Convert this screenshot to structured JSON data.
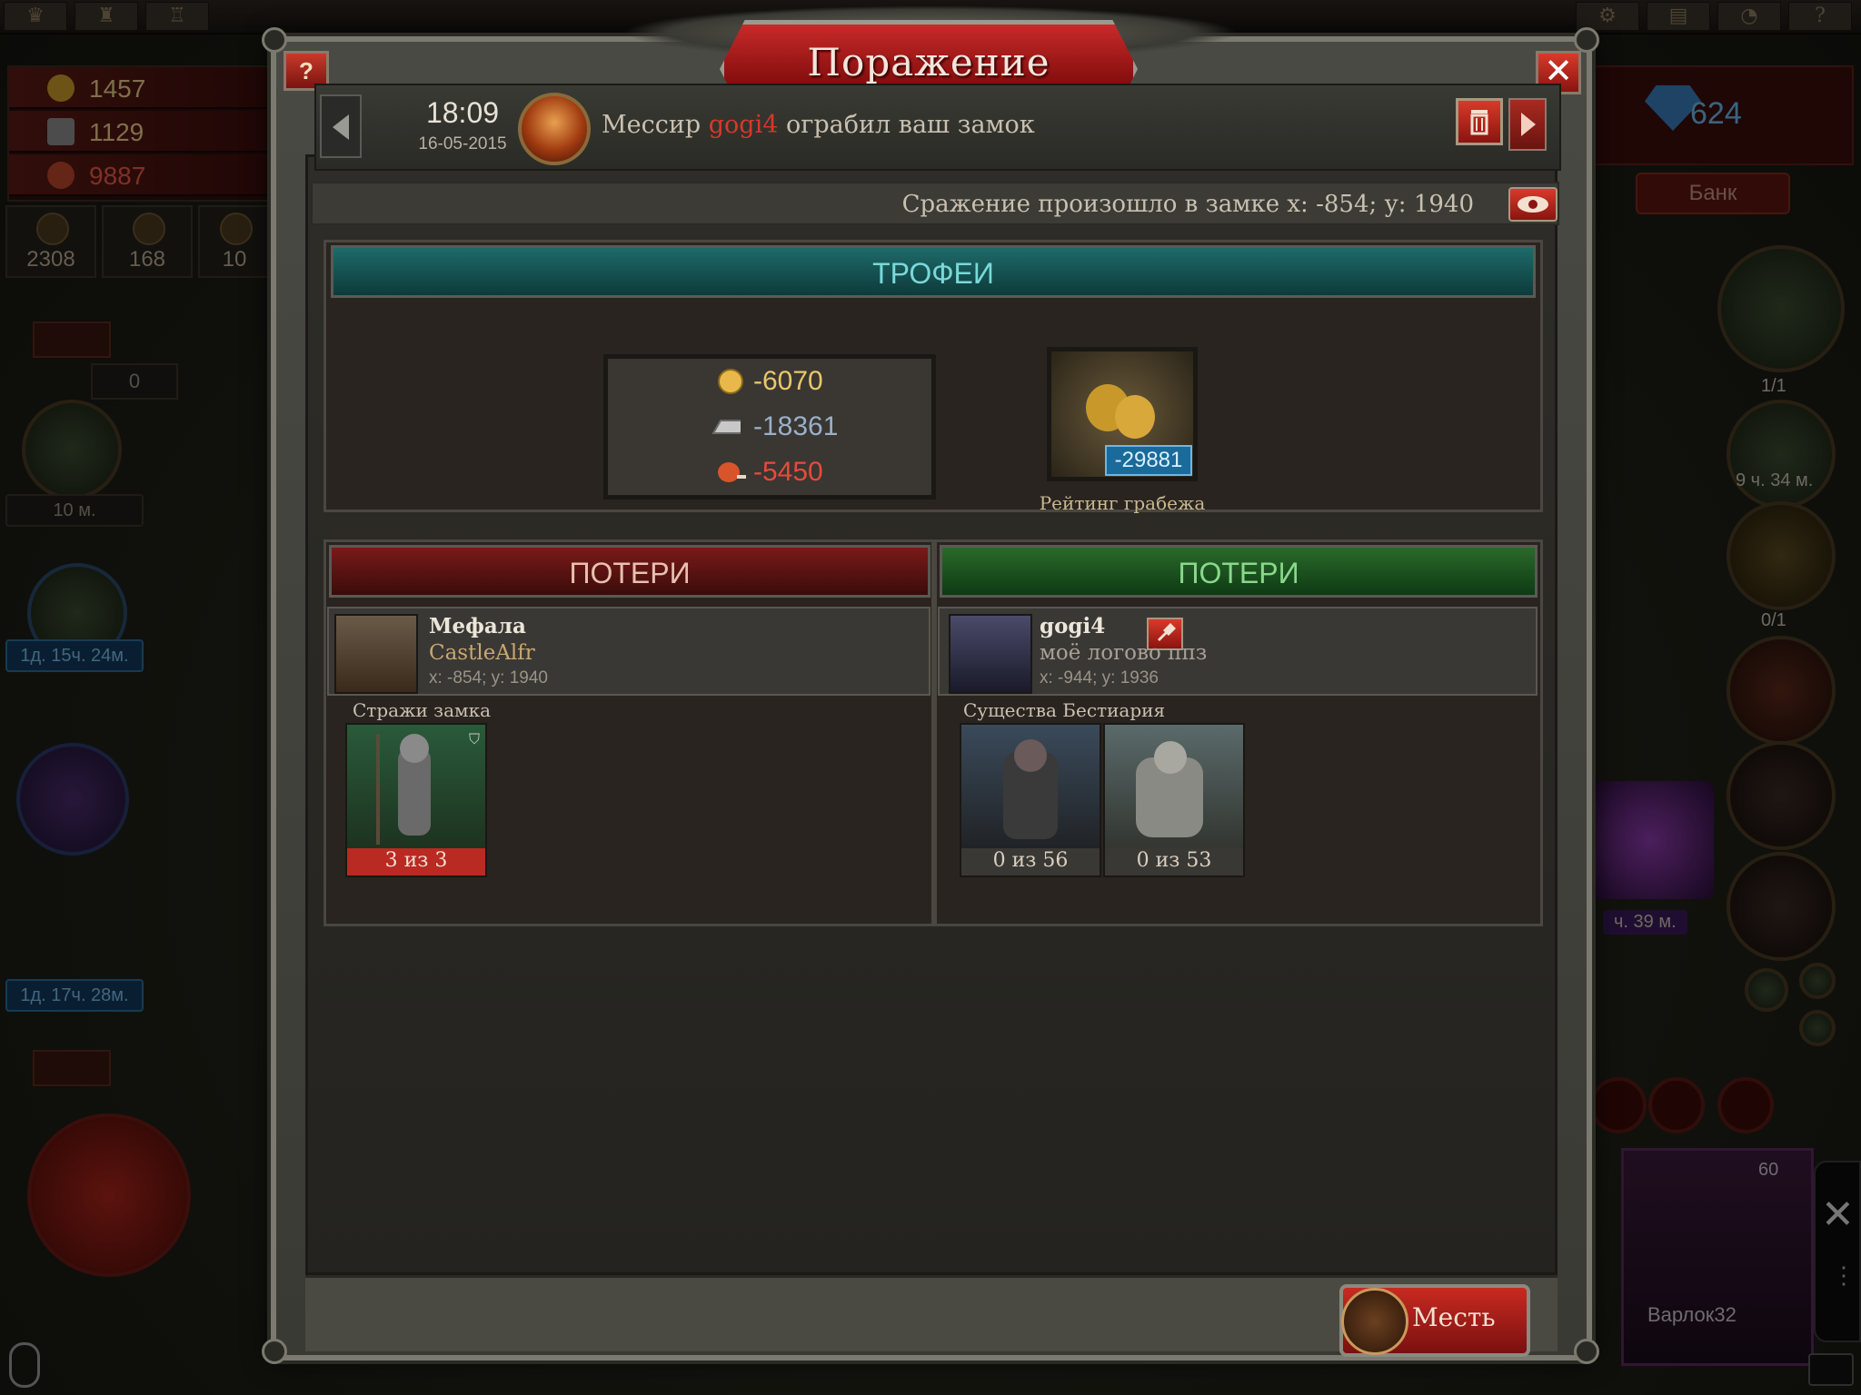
{
  "hud": {
    "resources": [
      {
        "name": "gold",
        "value": "1457",
        "color": "#e8b84a"
      },
      {
        "name": "iron",
        "value": "1129",
        "color": "#a0a0a0"
      },
      {
        "name": "food",
        "value": "9887",
        "color": "#c8542a"
      }
    ],
    "stats": [
      "2308",
      "168",
      "10"
    ],
    "counter": "0",
    "left_timers": [
      "10 м.",
      "1д. 15ч. 24м.",
      "1д. 17ч. 28м."
    ],
    "gems": "624",
    "bank_label": "Банк",
    "right_counts": [
      "1/1",
      "0/1"
    ],
    "right_timers": [
      "9 ч. 34 м.",
      "ч. 39 м."
    ],
    "player_label": "Варлок32",
    "player_level": "60"
  },
  "modal": {
    "title": "Поражение",
    "help_label": "?",
    "close_label": "✕",
    "report": {
      "time": "18:09",
      "date": "16-05-2015",
      "msg_prefix": "Мессир",
      "attacker": "gogi4",
      "msg_suffix": "ограбил ваш замок"
    },
    "battle_location": "Сражение произошло в замке х: -854; у: 1940",
    "trophies": {
      "header": "ТРОФЕИ",
      "gold": "-6070",
      "iron": "-18361",
      "food": "-5450",
      "rating_value": "-29881",
      "rating_label": "Рейтинг грабежа"
    },
    "defender": {
      "header": "ПОТЕРИ",
      "name": "Мефала",
      "castle": "CastleAlfr",
      "coords": "х: -854; у: 1940",
      "group_label": "Стражи замка",
      "units": [
        {
          "count": "3 из 3"
        }
      ]
    },
    "attacker_side": {
      "header": "ПОТЕРИ",
      "name": "gogi4",
      "castle": "моё логово ппз",
      "coords": "х: -944; у: 1936",
      "group_label": "Существа Бестиария",
      "units": [
        {
          "count": "0 из 56"
        },
        {
          "count": "0 из 53"
        }
      ]
    },
    "revenge_label": "Месть"
  },
  "colors": {
    "accent_red": "#d8382a",
    "defender_castle": "#c8a870",
    "attacker_castle": "#a8a098",
    "gold": "#e8c86a",
    "iron": "#9ab0c8",
    "food": "#e84a3a"
  }
}
